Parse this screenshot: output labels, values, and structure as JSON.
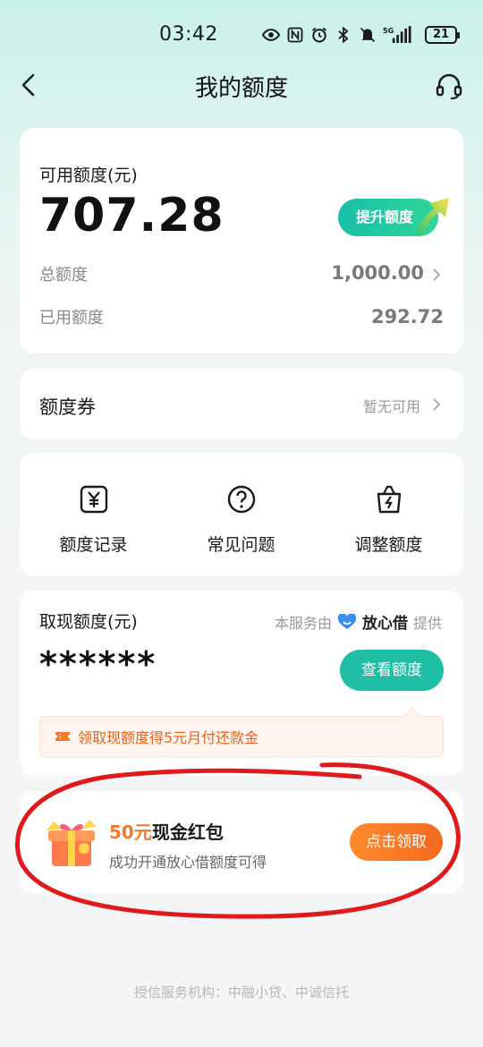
{
  "status_bar": {
    "time": "03:42",
    "battery": "21",
    "network": "5G",
    "icons": [
      "eye-icon",
      "nfc-icon",
      "alarm-icon",
      "bluetooth-icon",
      "vibrate-icon",
      "signal-icon",
      "battery-icon"
    ]
  },
  "nav": {
    "title": "我的额度",
    "back_icon": "chevron-left-icon",
    "service_icon": "headset-icon"
  },
  "credit": {
    "available_label": "可用额度(元)",
    "available_value": "707.28",
    "raise_button": "提升额度",
    "total_label": "总额度",
    "total_value": "1,000.00",
    "used_label": "已用额度",
    "used_value": "292.72"
  },
  "coupon": {
    "label": "额度券",
    "status": "暂无可用"
  },
  "tools": [
    {
      "label": "额度记录",
      "icon": "yuan-note-icon"
    },
    {
      "label": "常见问题",
      "icon": "question-circle-icon"
    },
    {
      "label": "调整额度",
      "icon": "lightning-bag-icon"
    }
  ],
  "cash": {
    "label": "取现额度(元)",
    "provider_prefix": "本服务由",
    "provider_brand": "放心借",
    "provider_suffix": "提供",
    "masked_value": "******",
    "view_button": "查看额度",
    "promo_text": "领取现额度得5元月付还款金"
  },
  "bonus": {
    "amount": "50元",
    "title_rest": "现金红包",
    "subtitle": "成功开通放心借额度可得",
    "claim_button": "点击领取"
  },
  "footer": {
    "text": "授信服务机构：中融小贷、中诚信托"
  },
  "colors": {
    "accent": "#1fbfa5",
    "orange": "#f36a1f",
    "annotation": "#e01a1a"
  }
}
